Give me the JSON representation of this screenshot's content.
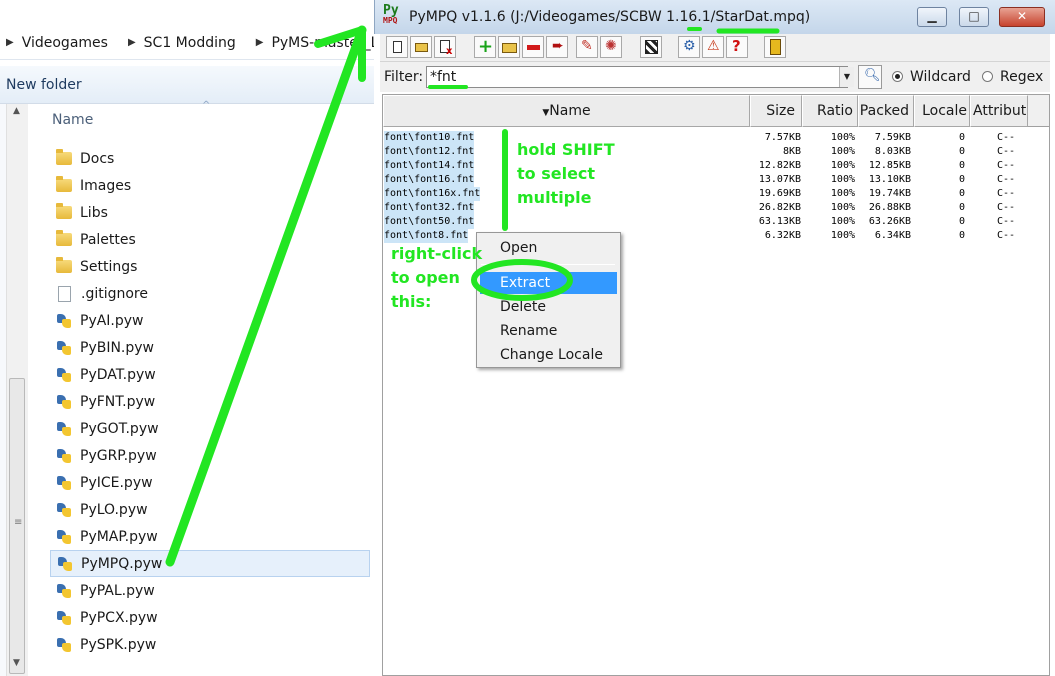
{
  "explorer": {
    "address": [
      "Videogames",
      "SC1 Modding",
      "PyMS-master_LO"
    ],
    "new_folder": "New folder",
    "column_name": "Name",
    "items": [
      {
        "name": "Docs",
        "icon": "folder-icon"
      },
      {
        "name": "Images",
        "icon": "folder-icon"
      },
      {
        "name": "Libs",
        "icon": "folder-icon"
      },
      {
        "name": "Palettes",
        "icon": "folder-icon"
      },
      {
        "name": "Settings",
        "icon": "folder-icon"
      },
      {
        "name": ".gitignore",
        "icon": "document-icon"
      },
      {
        "name": "PyAI.pyw",
        "icon": "python-file-icon"
      },
      {
        "name": "PyBIN.pyw",
        "icon": "python-file-icon"
      },
      {
        "name": "PyDAT.pyw",
        "icon": "python-file-icon"
      },
      {
        "name": "PyFNT.pyw",
        "icon": "python-file-icon"
      },
      {
        "name": "PyGOT.pyw",
        "icon": "python-file-icon"
      },
      {
        "name": "PyGRP.pyw",
        "icon": "python-file-icon"
      },
      {
        "name": "PyICE.pyw",
        "icon": "python-file-icon"
      },
      {
        "name": "PyLO.pyw",
        "icon": "python-file-icon"
      },
      {
        "name": "PyMAP.pyw",
        "icon": "python-file-icon"
      },
      {
        "name": "PyMPQ.pyw",
        "icon": "python-file-icon",
        "selected": true
      },
      {
        "name": "PyPAL.pyw",
        "icon": "python-file-icon"
      },
      {
        "name": "PyPCX.pyw",
        "icon": "python-file-icon"
      },
      {
        "name": "PySPK.pyw",
        "icon": "python-file-icon"
      }
    ]
  },
  "pympq": {
    "app_icon_text": "Py",
    "app_icon_sub": "MPQ",
    "title": "PyMPQ v1.1.6 (J:/Videogames/SCBW 1.16.1/StarDat.mpq)",
    "filter": {
      "label": "Filter:",
      "value": "*fnt",
      "wildcard_label": "Wildcard",
      "regex_label": "Regex",
      "mode": "Wildcard"
    },
    "columns": {
      "name": "Name",
      "size": "Size",
      "ratio": "Ratio",
      "packed": "Packed",
      "locale": "Locale",
      "attributes": "Attribut"
    },
    "files": [
      {
        "name": "font\\font10.fnt",
        "size": "7.57KB",
        "ratio": "100%",
        "packed": "7.59KB",
        "locale": "0",
        "attr": "C--"
      },
      {
        "name": "font\\font12.fnt",
        "size": "8KB",
        "ratio": "100%",
        "packed": "8.03KB",
        "locale": "0",
        "attr": "C--"
      },
      {
        "name": "font\\font14.fnt",
        "size": "12.82KB",
        "ratio": "100%",
        "packed": "12.85KB",
        "locale": "0",
        "attr": "C--"
      },
      {
        "name": "font\\font16.fnt",
        "size": "13.07KB",
        "ratio": "100%",
        "packed": "13.10KB",
        "locale": "0",
        "attr": "C--"
      },
      {
        "name": "font\\font16x.fnt",
        "size": "19.69KB",
        "ratio": "100%",
        "packed": "19.74KB",
        "locale": "0",
        "attr": "C--"
      },
      {
        "name": "font\\font32.fnt",
        "size": "26.82KB",
        "ratio": "100%",
        "packed": "26.88KB",
        "locale": "0",
        "attr": "C--"
      },
      {
        "name": "font\\font50.fnt",
        "size": "63.13KB",
        "ratio": "100%",
        "packed": "63.26KB",
        "locale": "0",
        "attr": "C--"
      },
      {
        "name": "font\\font8.fnt",
        "size": "6.32KB",
        "ratio": "100%",
        "packed": "6.34KB",
        "locale": "0",
        "attr": "C--"
      }
    ],
    "context_menu": {
      "items": [
        "Open",
        "Extract",
        "Delete",
        "Rename",
        "Change Locale"
      ],
      "highlighted": "Extract"
    }
  },
  "annotations": {
    "color": "#22e622",
    "shift_note": [
      "hold SHIFT",
      "to select",
      "multiple"
    ],
    "rightclick_note": [
      "right-click",
      "to open",
      "this:"
    ]
  },
  "colors": {
    "selection": "#cce5f7",
    "menu_highlight": "#3399ff",
    "close_button": "#c7432e"
  }
}
